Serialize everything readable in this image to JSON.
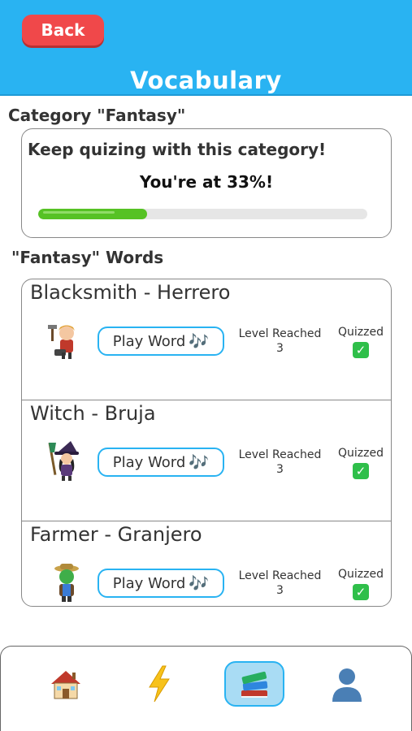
{
  "header": {
    "back_label": "Back",
    "title": "Vocabulary",
    "color": "#29b3f2"
  },
  "category": {
    "label": "Category \"Fantasy\"",
    "progress_message": "Keep quizing with this category!",
    "progress_text": "You're at 33%!",
    "progress_fraction": 0.33
  },
  "words_section": {
    "label": "\"Fantasy\" Words",
    "words": [
      {
        "title": "Blacksmith - Herrero",
        "play_label": "Play Word",
        "note": "🎶",
        "level_label": "Level Reached",
        "level": "3",
        "quizzed_label": "Quizzed",
        "quizzed_mark": "✓",
        "avatar_icon": "blacksmith-avatar-icon"
      },
      {
        "title": "Witch - Bruja",
        "play_label": "Play Word",
        "note": "🎶",
        "level_label": "Level Reached",
        "level": "3",
        "quizzed_label": "Quizzed",
        "quizzed_mark": "✓",
        "avatar_icon": "witch-avatar-icon"
      },
      {
        "title": "Farmer - Granjero",
        "play_label": "Play Word",
        "note": "🎶",
        "level_label": "Level Reached",
        "level": "3",
        "quizzed_label": "Quizzed",
        "quizzed_mark": "✓",
        "avatar_icon": "farmer-avatar-icon"
      }
    ]
  },
  "nav": {
    "items": [
      {
        "icon": "house-icon",
        "active": false
      },
      {
        "icon": "lightning-icon",
        "active": false
      },
      {
        "icon": "books-icon",
        "active": true
      },
      {
        "icon": "user-icon",
        "active": false
      }
    ]
  }
}
